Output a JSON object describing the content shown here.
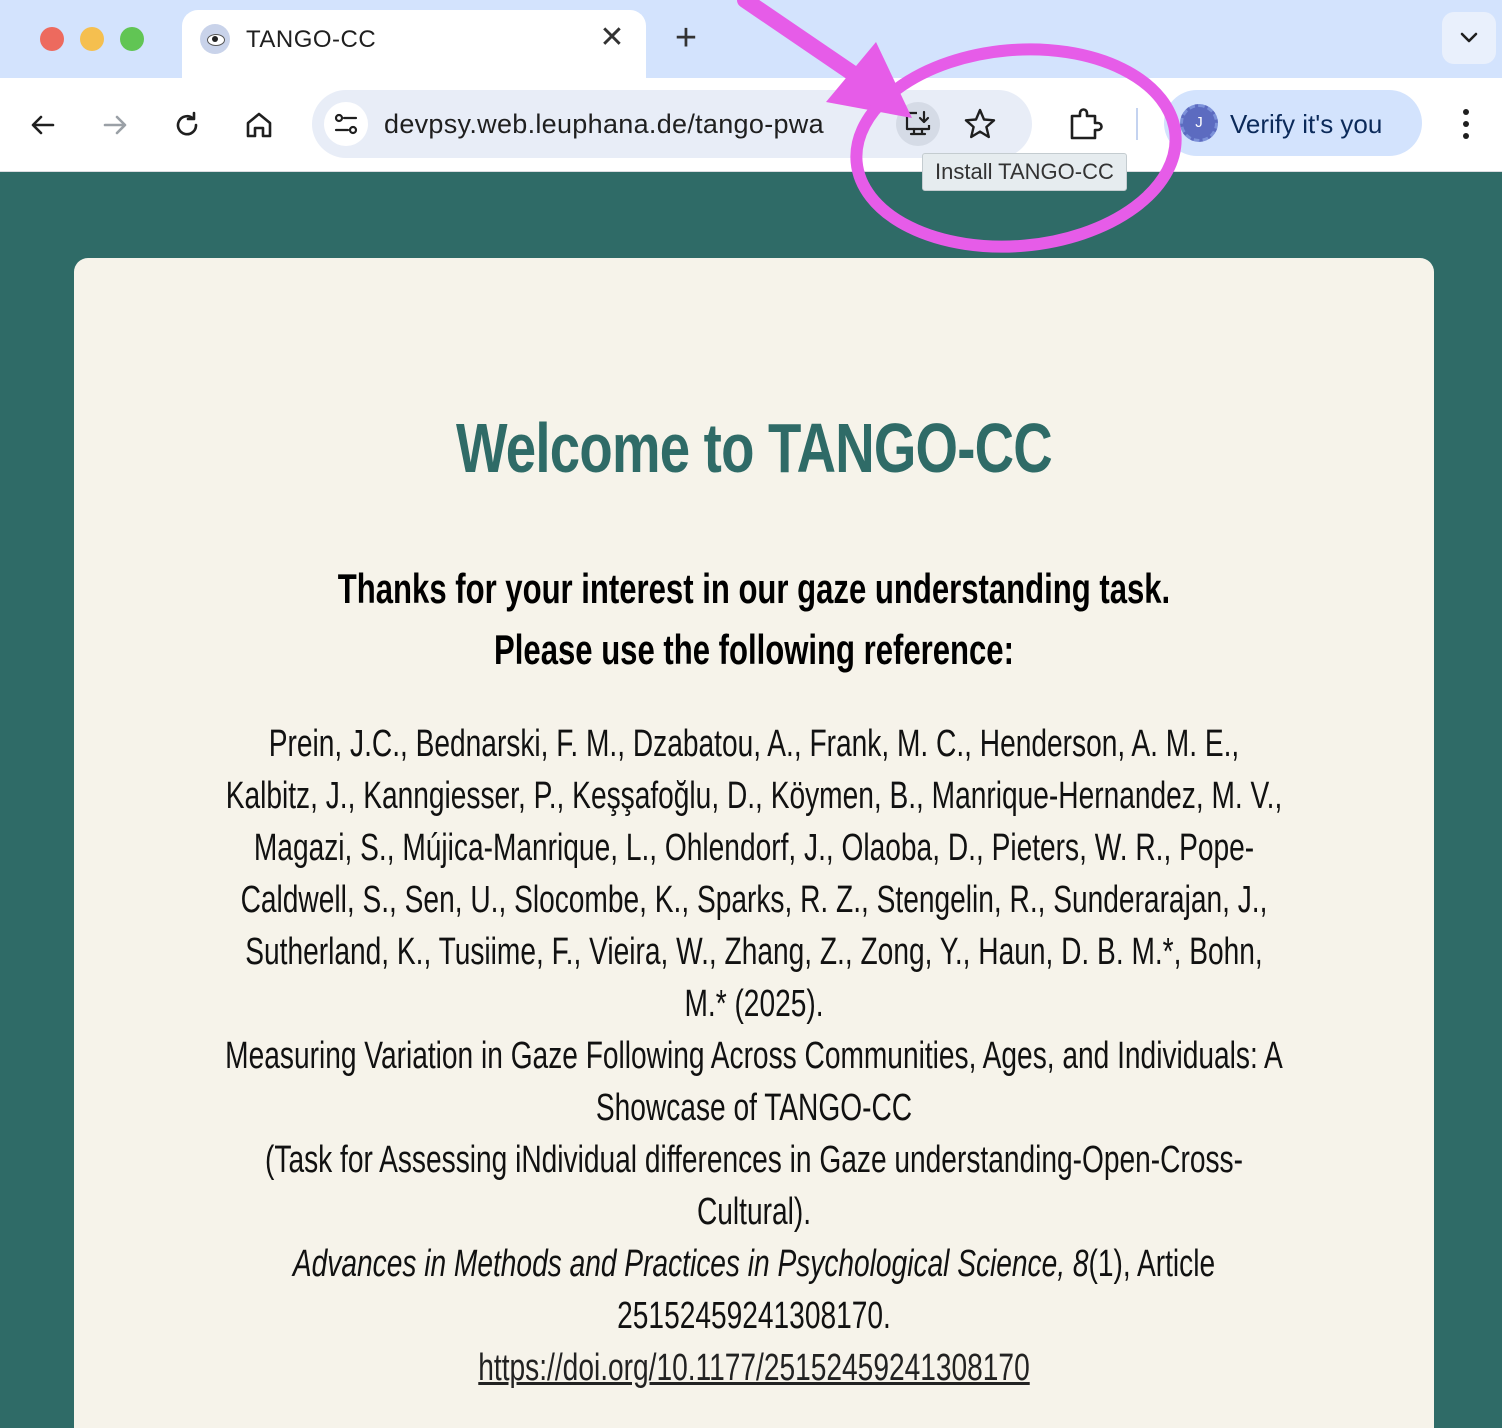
{
  "browser": {
    "tab": {
      "title": "TANGO-CC",
      "close_glyph": "✕"
    },
    "new_tab_glyph": "+",
    "url": "devpsy.web.leuphana.de/tango-pwa",
    "tooltip": "Install TANGO-CC",
    "profile": {
      "initial": "J",
      "label": "Verify it's you"
    },
    "annotation_color": "#e65ce8"
  },
  "page": {
    "title": "Welcome to TANGO-CC",
    "intro_line1": "Thanks for your interest in our gaze understanding task.",
    "intro_line2": "Please use the following reference:",
    "reference": {
      "authors": "Prein, J.C., Bednarski, F. M., Dzabatou, A., Frank, M. C., Henderson, A. M. E., Kalbitz, J., Kanngiesser, P., Keşşafoğlu, D., Köymen, B., Manrique-Hernandez, M. V., Magazi, S., Mújica-Manrique, L., Ohlendorf, J., Olaoba, D., Pieters, W. R., Pope-Caldwell, S., Sen, U., Slocombe, K., Sparks, R. Z., Stengelin, R., Sunderarajan, J., Sutherland, K., Tusiime, F., Vieira, W., Zhang, Z., Zong, Y., Haun, D. B. M.*, Bohn, M.*",
      "year": "(2025).",
      "article_title": "Measuring Variation in Gaze Following Across Communities, Ages, and Individuals: A Showcase of TANGO-CC",
      "acronym_expansion": "(Task for Assessing iNdividual differences in Gaze understanding-Open-Cross-Cultural).",
      "journal": "Advances in Methods and Practices in Psychological Science, 8",
      "issue_article": "(1), Article 25152459241308170.",
      "doi": "https://doi.org/10.1177/25152459241308170"
    }
  }
}
